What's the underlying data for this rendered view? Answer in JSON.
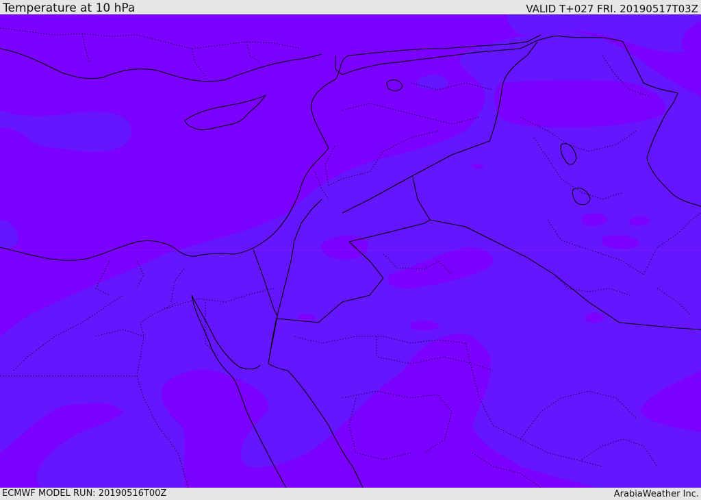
{
  "header": {
    "title": "Temperature at 10 hPa",
    "valid": "VALID T+027 FRI. 20190517T03Z"
  },
  "footer": {
    "model_run": "ECMWF MODEL RUN: 20190516T00Z",
    "credit": "ArabiaWeather Inc."
  },
  "map": {
    "colors": {
      "warmer_band": "#7b00ff",
      "cooler_band": "#6615ff",
      "borders": "#000000"
    }
  }
}
